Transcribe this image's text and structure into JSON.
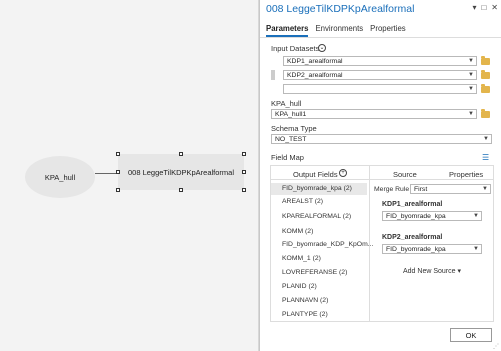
{
  "canvas": {
    "ellipse_label": "KPA_hull",
    "tool_label": "008 LeggeTilKDPKpArealformal"
  },
  "pane": {
    "title": "008 LeggeTilKDPKpArealformal",
    "tabs": [
      "Parameters",
      "Environments",
      "Properties"
    ],
    "input_datasets_label": "Input Datasets",
    "input_datasets": [
      "KDP1_arealformal",
      "KDP2_arealformal",
      ""
    ],
    "kpa_hull_label": "KPA_hull",
    "kpa_hull_value": "KPA_hull1",
    "schema_type_label": "Schema Type",
    "schema_type_value": "NO_TEST",
    "field_map_label": "Field Map",
    "output_fields_label": "Output Fields",
    "output_fields": [
      "FID_byomrade_kpa (2)",
      "AREALST (2)",
      "KPAREALFORMAL (2)",
      "KOMM (2)",
      "FID_byomrade_KDP_KpOm...",
      "KOMM_1 (2)",
      "LOVREFERANSE (2)",
      "PLANID (2)",
      "PLANNAVN (2)",
      "PLANTYPE (2)"
    ],
    "source_tab": "Source",
    "properties_tab": "Properties",
    "merge_rule_label": "Merge Rule",
    "merge_rule_value": "First",
    "sources": [
      {
        "name": "KDP1_arealformal",
        "field": "FID_byomrade_kpa"
      },
      {
        "name": "KDP2_arealformal",
        "field": "FID_byomrade_kpa"
      }
    ],
    "add_new_source": "Add New Source",
    "ok_label": "OK"
  }
}
